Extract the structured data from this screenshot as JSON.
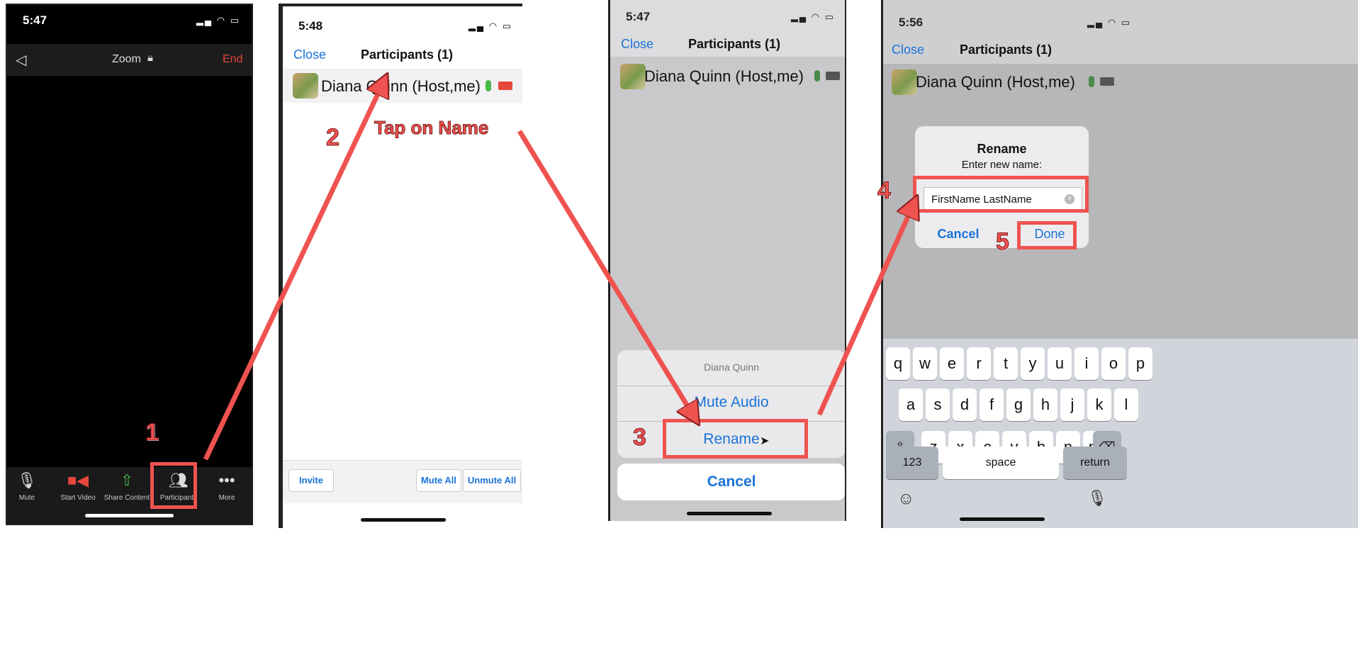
{
  "colors": {
    "accent": "#1a73d8",
    "annotation": "#ef5350",
    "zoom_bg": "#000000"
  },
  "panel1": {
    "time": "5:47",
    "title": "Zoom",
    "end_label": "End",
    "toolbar": [
      {
        "label": "Mute",
        "icon": "microphone-icon"
      },
      {
        "label": "Start Video",
        "icon": "video-off-icon"
      },
      {
        "label": "Share Content",
        "icon": "share-icon"
      },
      {
        "label": "Participants",
        "icon": "participants-icon"
      },
      {
        "label": "More",
        "icon": "more-icon"
      }
    ],
    "step": "1"
  },
  "panel2": {
    "time": "5:48",
    "close": "Close",
    "title": "Participants (1)",
    "participant": "Diana Quinn (Host,me)",
    "step": "2",
    "callout": "Tap on Name",
    "buttons": {
      "invite": "Invite",
      "mute_all": "Mute All",
      "unmute_all": "Unmute All"
    }
  },
  "panel3": {
    "time": "5:47",
    "close": "Close",
    "title": "Participants (1)",
    "participant": "Diana Quinn (Host,me)",
    "sheet_title": "Diana Quinn",
    "mute_audio": "Mute Audio",
    "rename": "Rename",
    "cancel": "Cancel",
    "step": "3"
  },
  "panel4": {
    "time": "5:56",
    "close": "Close",
    "title": "Participants (1)",
    "participant": "Diana Quinn (Host,me)",
    "dialog": {
      "title": "Rename",
      "subtitle": "Enter new name:",
      "value": "FirstName LastName",
      "cancel": "Cancel",
      "done": "Done"
    },
    "step4": "4",
    "step5": "5",
    "keyboard": {
      "row1": [
        "q",
        "w",
        "e",
        "r",
        "t",
        "y",
        "u",
        "i",
        "o",
        "p"
      ],
      "row2": [
        "a",
        "s",
        "d",
        "f",
        "g",
        "h",
        "j",
        "k",
        "l"
      ],
      "row3": [
        "z",
        "x",
        "c",
        "v",
        "b",
        "n",
        "m"
      ],
      "numbers": "123",
      "space": "space",
      "return": "return"
    }
  }
}
